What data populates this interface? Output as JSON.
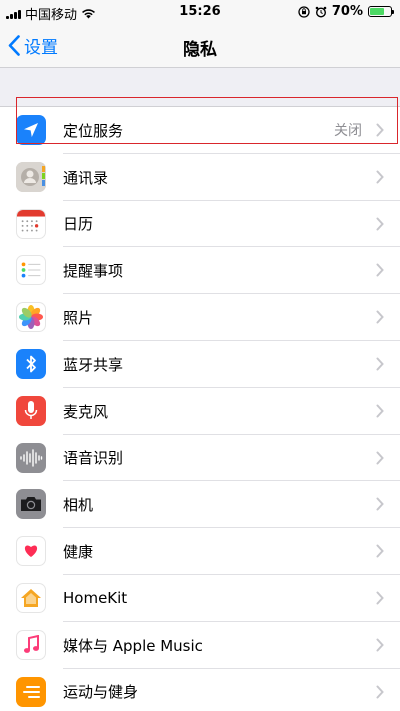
{
  "status_bar": {
    "carrier": "中国移动",
    "time": "15:26",
    "battery_percent": "70%",
    "battery_level": 0.7,
    "battery_color": "#4cd964"
  },
  "nav": {
    "back_label": "设置",
    "title": "隐私"
  },
  "items": [
    {
      "label": "定位服务",
      "value": "关闭",
      "icon": "location-arrow-icon"
    },
    {
      "label": "通讯录",
      "value": "",
      "icon": "contacts-icon"
    },
    {
      "label": "日历",
      "value": "",
      "icon": "calendar-icon"
    },
    {
      "label": "提醒事项",
      "value": "",
      "icon": "reminders-icon"
    },
    {
      "label": "照片",
      "value": "",
      "icon": "photos-icon"
    },
    {
      "label": "蓝牙共享",
      "value": "",
      "icon": "bluetooth-icon"
    },
    {
      "label": "麦克风",
      "value": "",
      "icon": "microphone-icon"
    },
    {
      "label": "语音识别",
      "value": "",
      "icon": "speech-recognition-icon"
    },
    {
      "label": "相机",
      "value": "",
      "icon": "camera-icon"
    },
    {
      "label": "健康",
      "value": "",
      "icon": "health-heart-icon"
    },
    {
      "label": "HomeKit",
      "value": "",
      "icon": "homekit-house-icon"
    },
    {
      "label": "媒体与 Apple Music",
      "value": "",
      "icon": "music-note-icon"
    },
    {
      "label": "运动与健身",
      "value": "",
      "icon": "motion-fitness-icon"
    }
  ],
  "colors": {
    "accent": "#007aff",
    "highlight_box": "#d9262c"
  }
}
